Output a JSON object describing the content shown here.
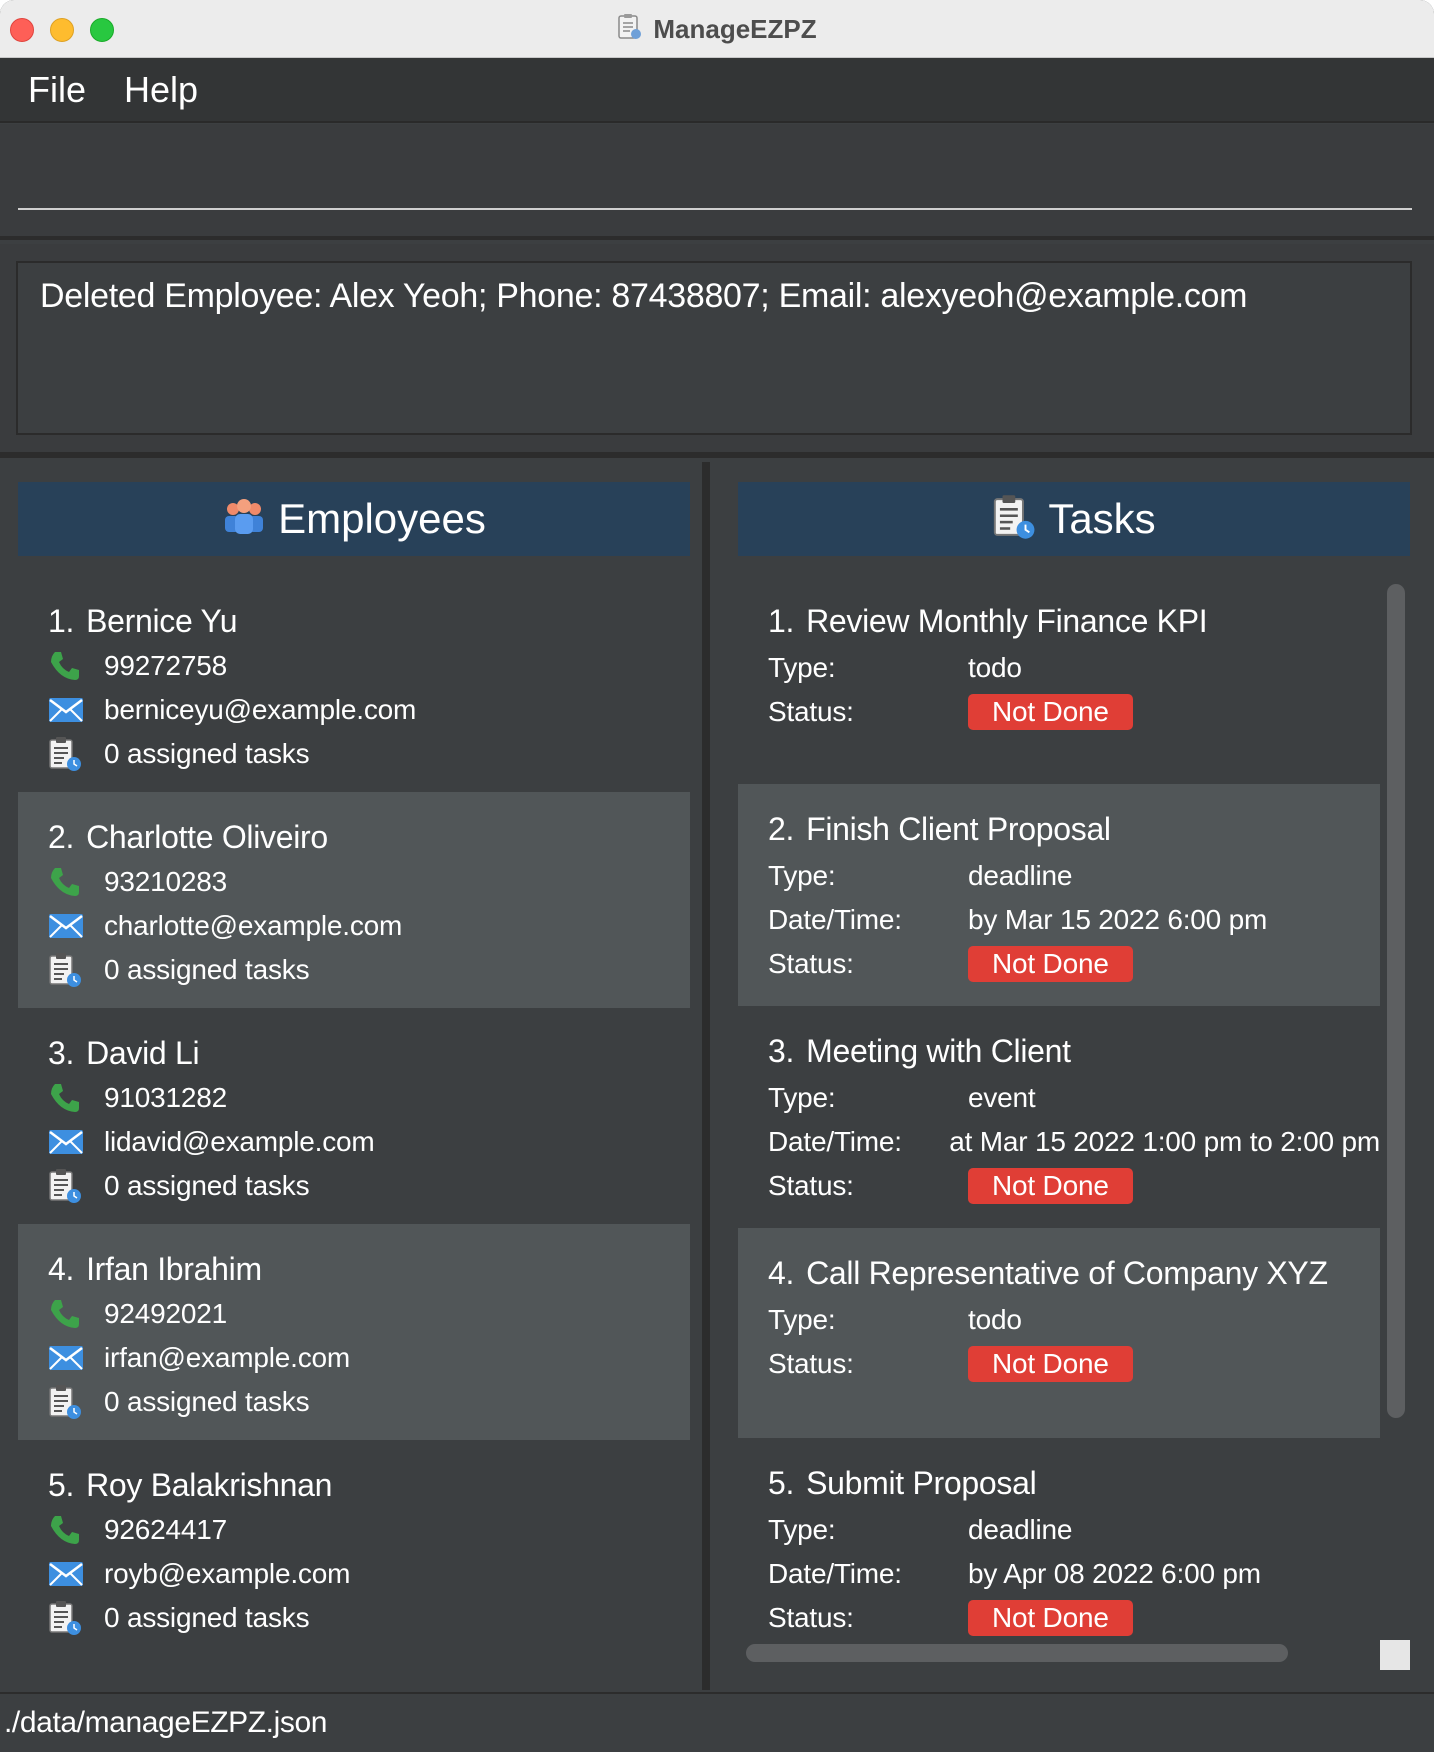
{
  "window": {
    "title": "ManageEZPZ"
  },
  "menu": {
    "items": [
      "File",
      "Help"
    ]
  },
  "command": {
    "value": ""
  },
  "result": {
    "text": "Deleted Employee: Alex Yeoh; Phone: 87438807; Email: alexyeoh@example.com"
  },
  "employees": {
    "header": "Employees",
    "items": [
      {
        "index": "1.",
        "name": "Bernice Yu",
        "phone": "99272758",
        "email": "berniceyu@example.com",
        "tasks": "0 assigned tasks"
      },
      {
        "index": "2.",
        "name": "Charlotte Oliveiro",
        "phone": "93210283",
        "email": "charlotte@example.com",
        "tasks": "0 assigned tasks"
      },
      {
        "index": "3.",
        "name": "David Li",
        "phone": "91031282",
        "email": "lidavid@example.com",
        "tasks": "0 assigned tasks"
      },
      {
        "index": "4.",
        "name": "Irfan Ibrahim",
        "phone": "92492021",
        "email": "irfan@example.com",
        "tasks": "0 assigned tasks"
      },
      {
        "index": "5.",
        "name": "Roy Balakrishnan",
        "phone": "92624417",
        "email": "royb@example.com",
        "tasks": "0 assigned tasks"
      }
    ]
  },
  "tasks": {
    "header": "Tasks",
    "labels": {
      "type": "Type:",
      "datetime": "Date/Time:",
      "status": "Status:"
    },
    "items": [
      {
        "index": "1.",
        "name": "Review Monthly Finance KPI",
        "type": "todo",
        "status": "Not Done"
      },
      {
        "index": "2.",
        "name": "Finish Client Proposal",
        "type": "deadline",
        "datetime": "by Mar 15 2022 6:00 pm",
        "status": "Not Done"
      },
      {
        "index": "3.",
        "name": "Meeting with Client",
        "type": "event",
        "datetime": "at Mar 15 2022 1:00 pm to 2:00 pm",
        "status": "Not Done"
      },
      {
        "index": "4.",
        "name": "Call Representative of Company XYZ",
        "type": "todo",
        "status": "Not Done"
      },
      {
        "index": "5.",
        "name": "Submit Proposal",
        "type": "deadline",
        "datetime": "by Apr 08 2022 6:00 pm",
        "status": "Not Done"
      }
    ]
  },
  "statusbar": {
    "path": "./data/manageEZPZ.json"
  },
  "colors": {
    "panel_header": "#284159",
    "badge": "#e03e36",
    "background": "#3c3f41",
    "alt_row": "#515658"
  },
  "icons": {
    "phone": "phone-icon",
    "email": "email-icon",
    "tasks": "task-list-icon",
    "employees": "employees-icon"
  }
}
